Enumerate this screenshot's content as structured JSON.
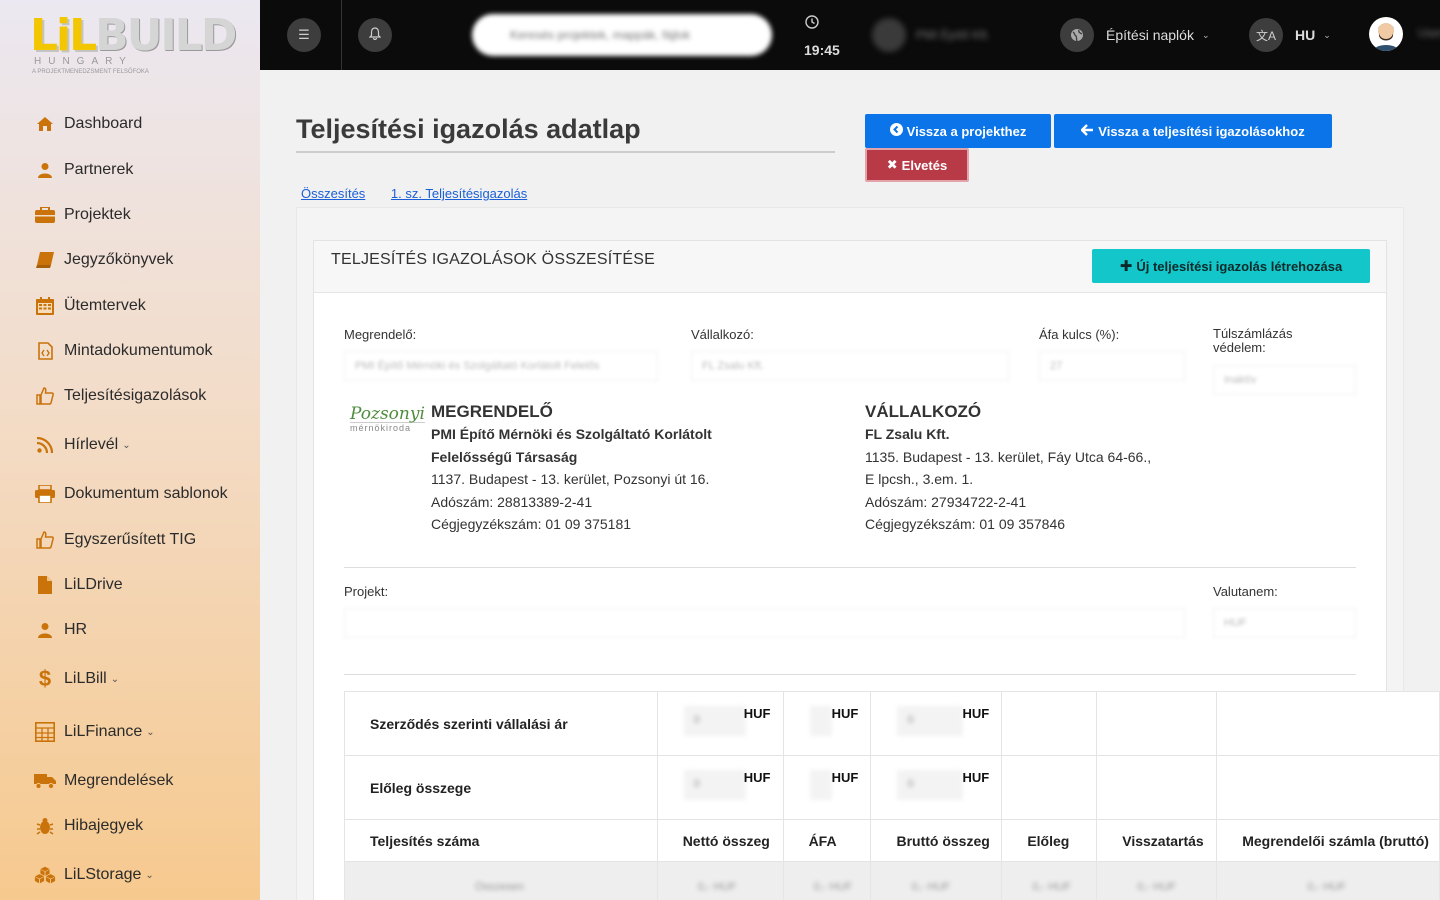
{
  "logo": {
    "word_li": "LiL",
    "word_rest": "BUILD",
    "sub": "HUNGARY",
    "tagline": "A PROJEKTMENEDZSMENT FELSŐFOKA"
  },
  "sidebar": {
    "items": [
      {
        "label": "Dashboard",
        "icon": "home-icon"
      },
      {
        "label": "Partnerek",
        "icon": "user-icon"
      },
      {
        "label": "Projektek",
        "icon": "briefcase-icon"
      },
      {
        "label": "Jegyzőkönyvek",
        "icon": "book-icon"
      },
      {
        "label": "Ütemtervek",
        "icon": "calendar-icon"
      },
      {
        "label": "Mintadokumentumok",
        "icon": "file-code-icon"
      },
      {
        "label": "Teljesítésigazolások",
        "icon": "thumbs-up-icon"
      },
      {
        "label": "Hírlevél",
        "icon": "rss-icon"
      },
      {
        "label": "Dokumentum sablonok",
        "icon": "printer-icon"
      },
      {
        "label": "Egyszerűsített TIG",
        "icon": "thumbs-up-icon"
      },
      {
        "label": "LiLDrive",
        "icon": "file-icon"
      },
      {
        "label": "HR",
        "icon": "user-icon"
      },
      {
        "label": "LiLBill",
        "icon": "dollar-icon"
      },
      {
        "label": "LiLFinance",
        "icon": "calculator-icon"
      },
      {
        "label": "Megrendelések",
        "icon": "truck-icon"
      },
      {
        "label": "Hibajegyek",
        "icon": "bug-icon"
      },
      {
        "label": "LiLStorage",
        "icon": "cubes-icon"
      }
    ]
  },
  "topbar": {
    "search_placeholder": "Keresés projektek, mappák, fájlok",
    "time": "19:45",
    "user_company": "PMI Építő Kft.",
    "logs_label": "Építési naplók",
    "lang": "HU",
    "user_name": "User"
  },
  "page": {
    "title": "Teljesítési igazolás adatlap",
    "btn_back_project": "Vissza a projekthez",
    "btn_back_list": "Vissza a teljesítési igazolásokhoz",
    "btn_discard": "Elvetés",
    "crumbs": [
      "Összesítés",
      "1. sz. Teljesítésigazolás"
    ]
  },
  "card": {
    "title": "TELJESÍTÉS IGAZOLÁSOK ÖSSZESÍTÉSE",
    "btn_new": "Új teljesítési igazolás létrehozása",
    "fields": {
      "megrendelo_label": "Megrendelő:",
      "megrendelo_value": "PMI Építő Mérnöki és Szolgáltató Korlátolt Felelős",
      "vallalkozo_label": "Vállalkozó:",
      "vallalkozo_value": "FL Zsalu Kft.",
      "afa_label": "Áfa kulcs (%):",
      "afa_value": "27",
      "tulszamla_label_1": "Túlszámlázás",
      "tulszamla_label_2": "védelem:",
      "tulszamla_value": "Inaktív",
      "projekt_label": "Projekt:",
      "projekt_value": "",
      "valuta_label": "Valutanem:",
      "valuta_value": "HUF"
    },
    "megrendelo": {
      "logo_name": "Pozsonyi",
      "logo_sub": "mérnökiroda",
      "head": "MEGRENDELŐ",
      "name_1": "PMI Építő Mérnöki és Szolgáltató Korlátolt",
      "name_2": "Felelősségű Társaság",
      "address": "1137. Budapest - 13. kerület, Pozsonyi út 16.",
      "tax": "Adószám: 28813389-2-41",
      "reg": "Cégjegyzékszám: 01 09 375181"
    },
    "vallalkozo": {
      "head": "VÁLLALKOZÓ",
      "name": "FL Zsalu Kft.",
      "address_1": "1135. Budapest - 13. kerület, Fáy Utca 64-66.,",
      "address_2": "E lpcsh., 3.em. 1.",
      "tax": "Adószám: 27934722-2-41",
      "reg": "Cégjegyzékszám: 01 09 357846"
    },
    "table": {
      "row1_label": "Szerződés szerinti vállalási ár",
      "row2_label": "Előleg összege",
      "unit": "HUF",
      "val_zero": "0",
      "headers": [
        "Teljesítés száma",
        "Nettó összeg",
        "ÁFA",
        "Bruttó összeg",
        "Előleg",
        "Visszatartás",
        "Megrendelői számla (bruttó)"
      ],
      "blur_row": [
        "Összesen",
        "0,- HUF",
        "0,- HUF",
        "0,- HUF",
        "0,- HUF",
        "0,- HUF",
        "0,- HUF"
      ]
    }
  }
}
